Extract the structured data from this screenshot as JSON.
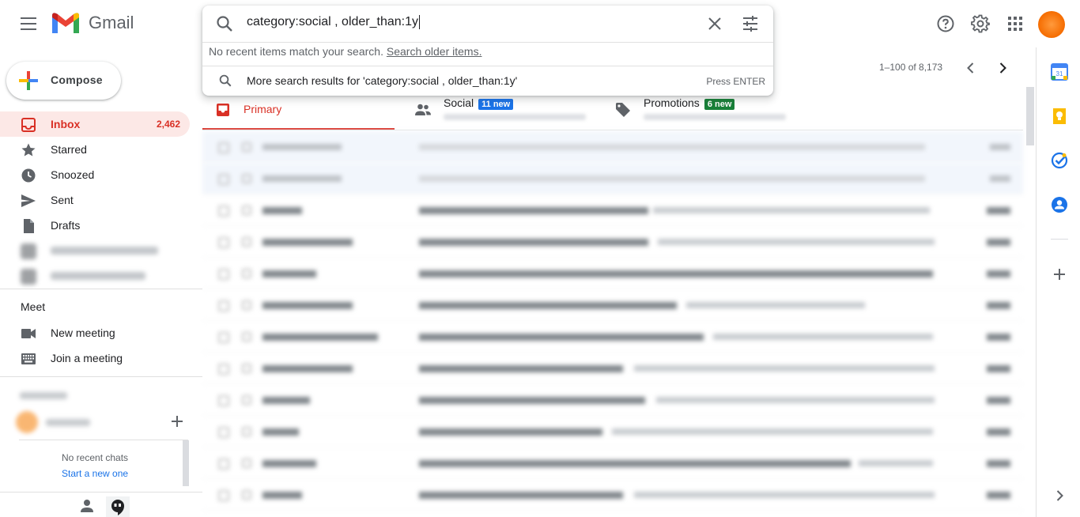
{
  "app": {
    "name": "Gmail"
  },
  "search": {
    "query": "category:social , older_than:1y",
    "no_recent_text": "No recent items match your search.",
    "search_older_link": "Search older items.",
    "more_results_text": "More search results for 'category:social , older_than:1y'",
    "press_enter": "Press ENTER"
  },
  "sidebar": {
    "compose_label": "Compose",
    "items": [
      {
        "label": "Inbox",
        "count": "2,462",
        "icon": "inbox-icon"
      },
      {
        "label": "Starred",
        "icon": "star-icon"
      },
      {
        "label": "Snoozed",
        "icon": "clock-icon"
      },
      {
        "label": "Sent",
        "icon": "send-icon"
      },
      {
        "label": "Drafts",
        "icon": "draft-icon"
      }
    ],
    "meet_title": "Meet",
    "meet_items": [
      {
        "label": "New meeting",
        "icon": "video-icon"
      },
      {
        "label": "Join a meeting",
        "icon": "keyboard-icon"
      }
    ],
    "no_chats": "No recent chats",
    "start_new": "Start a new one"
  },
  "pager": {
    "range": "1–100 of 8,173"
  },
  "tabs": [
    {
      "label": "Primary"
    },
    {
      "label": "Social",
      "badge": "11 new",
      "badge_color": "#1a73e8"
    },
    {
      "label": "Promotions",
      "badge": "6 new",
      "badge_color": "#188038"
    }
  ],
  "colors": {
    "accent_red": "#d93025",
    "blue": "#1a73e8",
    "green": "#188038"
  }
}
